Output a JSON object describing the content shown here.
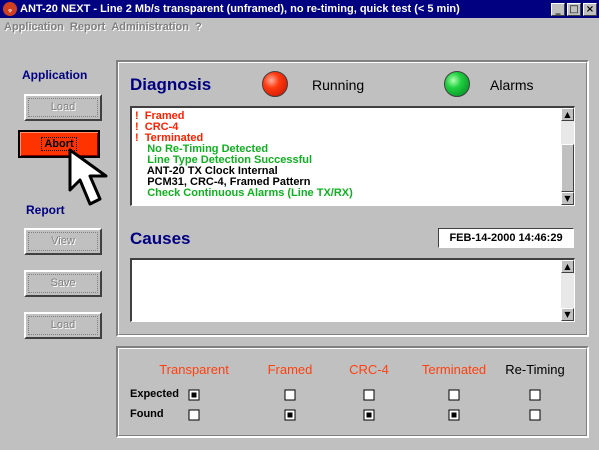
{
  "window": {
    "title": "ANT-20 NEXT - Line 2 Mb/s transparent (unframed), no re-timing, quick test (< 5 min)",
    "app_icon": "ant20-logo-icon",
    "buttons": [
      "_",
      "□",
      "×"
    ]
  },
  "menubar": [
    "Application",
    "Report",
    "Administration",
    "?"
  ],
  "sidebar": {
    "application_label": "Application",
    "application_buttons": {
      "load": "Load",
      "abort": "Abort"
    },
    "report_label": "Report",
    "report_buttons": {
      "view": "View",
      "save": "Save",
      "load": "Load"
    }
  },
  "diagnosis": {
    "title": "Diagnosis",
    "running_label": "Running",
    "running_status": "red",
    "alarms_label": "Alarms",
    "alarms_status": "green",
    "messages": [
      {
        "text": "!  Framed",
        "color": "#ff2000"
      },
      {
        "text": "!  CRC-4",
        "color": "#ff2000"
      },
      {
        "text": "!  Terminated",
        "color": "#ff2000"
      },
      {
        "text": "    No Re-Timing Detected",
        "color": "#10b020"
      },
      {
        "text": "    Line Type Detection Successful",
        "color": "#10b020"
      },
      {
        "text": "    ANT-20 TX Clock Internal",
        "color": "#000000"
      },
      {
        "text": "    PCM31, CRC-4, Framed Pattern",
        "color": "#000000"
      },
      {
        "text": "    Check Continuous Alarms (Line TX/RX)",
        "color": "#10b020"
      }
    ]
  },
  "causes": {
    "title": "Causes",
    "timestamp": "FEB-14-2000   14:46:29"
  },
  "results": {
    "columns": [
      {
        "label": "Transparent",
        "color": "#ff4010"
      },
      {
        "label": "Framed",
        "color": "#ff4010"
      },
      {
        "label": "CRC-4",
        "color": "#ff4010"
      },
      {
        "label": "Terminated",
        "color": "#ff4010"
      },
      {
        "label": "Re-Timing",
        "color": "#000000"
      }
    ],
    "rows": [
      {
        "label": "Expected",
        "checks": [
          true,
          false,
          false,
          false,
          false
        ]
      },
      {
        "label": "Found",
        "checks": [
          false,
          true,
          true,
          true,
          false
        ]
      }
    ]
  },
  "cursor": "arrow-pointer-icon"
}
